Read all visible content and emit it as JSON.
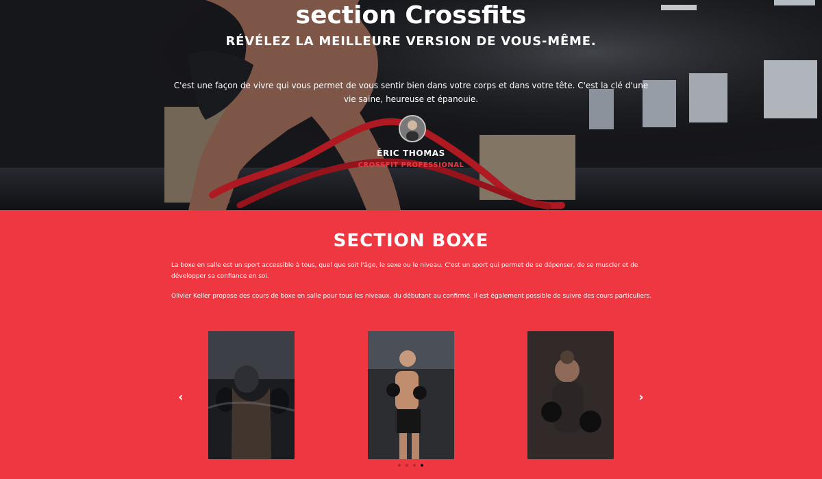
{
  "hero": {
    "title": "section Crossfits",
    "subtitle": "RÉVÉLEZ LA MEILLEURE VERSION DE VOUS-MÊME.",
    "description": "C'est une façon de vivre qui vous permet de vous sentir bien dans votre corps et dans votre tête. C'est la clé d'une vie saine, heureuse et épanouie.",
    "author_name": "ÉRIC THOMAS",
    "author_role": "CROSSFIT PROFESSIONAL",
    "icons": {
      "avatar": "author-avatar-photo"
    }
  },
  "boxe": {
    "title": "SECTION BOXE",
    "paragraph_1": "La boxe en salle est un sport accessible à tous, quel que soit l'âge, le sexe ou le niveau. C'est un sport qui permet de se dépenser, de se muscler et de développer sa confiance en soi.",
    "paragraph_2": "Olivier Keller propose des cours de boxe en salle pour tous les niveaux, du débutant au confirmé. Il est également possible de suivre des cours particuliers.",
    "carousel": {
      "prev_icon": "chevron-left-icon",
      "next_icon": "chevron-right-icon",
      "slides": [
        "boxer-smoke-photo",
        "boxer-gym-photo",
        "female-boxer-photo"
      ],
      "dots_count": 4,
      "active_dot": 4
    }
  },
  "colors": {
    "accent": "#ef3742",
    "text": "#ffffff",
    "dark": "#111111"
  }
}
